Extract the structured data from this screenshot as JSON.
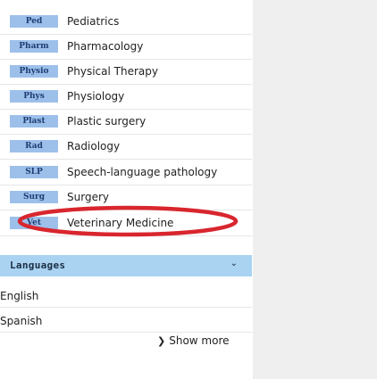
{
  "specialties": [
    {
      "abbr": "Ped",
      "label": "Pediatrics"
    },
    {
      "abbr": "Pharm",
      "label": "Pharmacology"
    },
    {
      "abbr": "Physio",
      "label": "Physical Therapy"
    },
    {
      "abbr": "Phys",
      "label": "Physiology"
    },
    {
      "abbr": "Plast",
      "label": "Plastic surgery"
    },
    {
      "abbr": "Rad",
      "label": "Radiology"
    },
    {
      "abbr": "SLP",
      "label": "Speech-language pathology"
    },
    {
      "abbr": "Surg",
      "label": "Surgery"
    },
    {
      "abbr": "Vet",
      "label": "Veterinary Medicine"
    }
  ],
  "languages": {
    "title": "Languages",
    "chevron": "⌄",
    "items": [
      "English",
      "Spanish"
    ],
    "show_more": "Show more",
    "show_more_icon": "chevron-right-icon"
  },
  "highlight": {
    "target": "Veterinary Medicine",
    "color": "#d9262e"
  },
  "colors": {
    "badge_bg": "#9dc0eb",
    "badge_text": "#1f3d72",
    "header_bg": "#a9d3f1",
    "right_panel_bg": "#efefef"
  }
}
